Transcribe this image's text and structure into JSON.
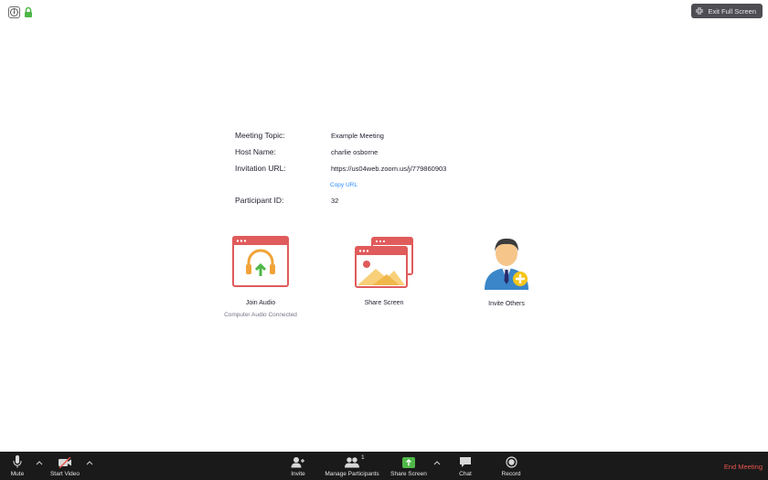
{
  "top_bar": {
    "exit_full_screen_label": "Exit Full Screen"
  },
  "meeting_info": {
    "topic_label": "Meeting Topic:",
    "topic_value": "Example Meeting",
    "host_label": "Host Name:",
    "host_value": "charlie osborne",
    "url_label": "Invitation URL:",
    "url_value": "https://us04web.zoom.us/j/779860903",
    "copy_url_label": "Copy URL",
    "participant_label": "Participant ID:",
    "participant_value": "32"
  },
  "actions": {
    "join_audio_label": "Join Audio",
    "join_audio_sub": "Computer Audio Connected",
    "share_screen_label": "Share Screen",
    "invite_others_label": "Invite Others"
  },
  "toolbar": {
    "mute_label": "Mute",
    "start_video_label": "Start Video",
    "invite_label": "Invite",
    "manage_participants_label": "Manage Participants",
    "participant_count": "1",
    "share_screen_label": "Share Screen",
    "chat_label": "Chat",
    "record_label": "Record",
    "end_meeting_label": "End Meeting"
  },
  "colors": {
    "accent_blue": "#2d8cff",
    "end_meeting_red": "#e8554e",
    "share_green": "#4fb748",
    "tile_red": "#e05b5b",
    "toolbar_bg": "#1a1a1a"
  },
  "icons": {
    "info": "info-icon",
    "lock": "lock-icon",
    "exit_full_screen": "exit-full-screen-icon",
    "join_audio": "headphones-icon",
    "share_screen": "share-screen-icon",
    "invite_others": "person-add-icon",
    "mute": "microphone-icon",
    "start_video": "video-off-icon",
    "invite": "invite-person-icon",
    "manage_participants": "participants-icon",
    "share_screen_toolbar": "share-arrow-icon",
    "chat": "chat-bubble-icon",
    "record": "record-icon"
  }
}
